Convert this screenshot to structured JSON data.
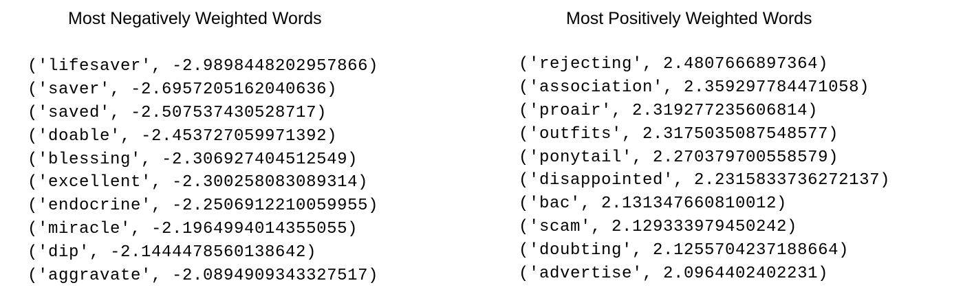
{
  "negative": {
    "title": "Most Negatively Weighted Words",
    "rows": [
      "('lifesaver', -2.9898448202957866)",
      "('saver', -2.6957205162040636)",
      "('saved', -2.507537430528717)",
      "('doable', -2.453727059971392)",
      "('blessing', -2.306927404512549)",
      "('excellent', -2.300258083089314)",
      "('endocrine', -2.2506912210059955)",
      "('miracle', -2.1964994014355055)",
      "('dip', -2.1444478560138642)",
      "('aggravate', -2.0894909343327517)"
    ]
  },
  "positive": {
    "title": "Most Positively Weighted Words",
    "rows": [
      "('rejecting', 2.4807666897364)",
      "('association', 2.359297784471058)",
      "('proair', 2.319277235606814)",
      "('outfits', 2.3175035087548577)",
      "('ponytail', 2.270379700558579)",
      "('disappointed', 2.2315833736272137)",
      "('bac', 2.131347660810012)",
      "('scam', 2.129333979450242)",
      "('doubting', 2.1255704237188664)",
      "('advertise', 2.0964402402231)"
    ]
  }
}
